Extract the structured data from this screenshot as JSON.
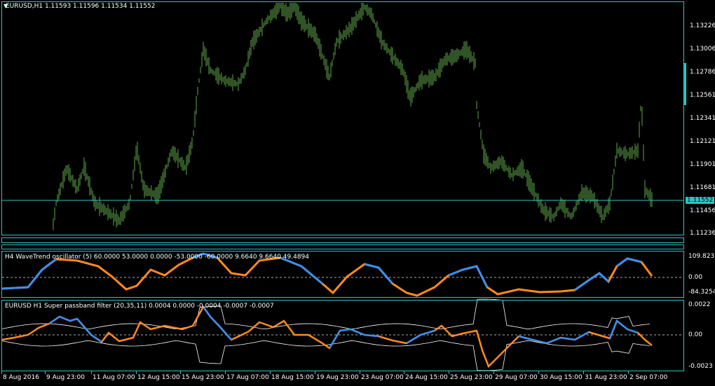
{
  "main": {
    "title": "EURUSD,H1  1.11593 1.11596 1.11534 1.11552",
    "price_labels": [
      "1.13226",
      "1.13006",
      "1.12786",
      "1.12561",
      "1.12341",
      "1.12121",
      "1.11901",
      "1.11681",
      "1.11456",
      "1.11236"
    ],
    "current_price": "1.11552"
  },
  "wavetrend": {
    "title": "H4 WaveTrend oscillator (5) 60.0000 53.0000 0.0000 -53.0000 -60.0000 9.6640 9.6640 49.4894",
    "labels": [
      "109.8231",
      "0.00",
      "-84.3254"
    ]
  },
  "passband": {
    "title": "EURUSD H1  Super passband filter (20,35,11) 0.0004 0.0000 -0.0004 -0.0007 -0.0007",
    "labels": [
      "0.0022",
      "0.00",
      "-0.0023"
    ]
  },
  "time_axis": [
    "8 Aug 2016",
    "9 Aug 23:00",
    "11 Aug 07:00",
    "12 Aug 15:00",
    "15 Aug 23:00",
    "17 Aug 07:00",
    "18 Aug 15:00",
    "19 Aug 23:00",
    "23 Aug 07:00",
    "24 Aug 15:00",
    "25 Aug 23:00",
    "29 Aug 07:00",
    "30 Aug 15:00",
    "31 Aug 23:00",
    "2 Sep 07:00"
  ],
  "colors": {
    "frame": "#2ec4c4",
    "bars": "#5fa84a",
    "blue": "#3a8ef0",
    "orange": "#ff8a1f"
  }
}
